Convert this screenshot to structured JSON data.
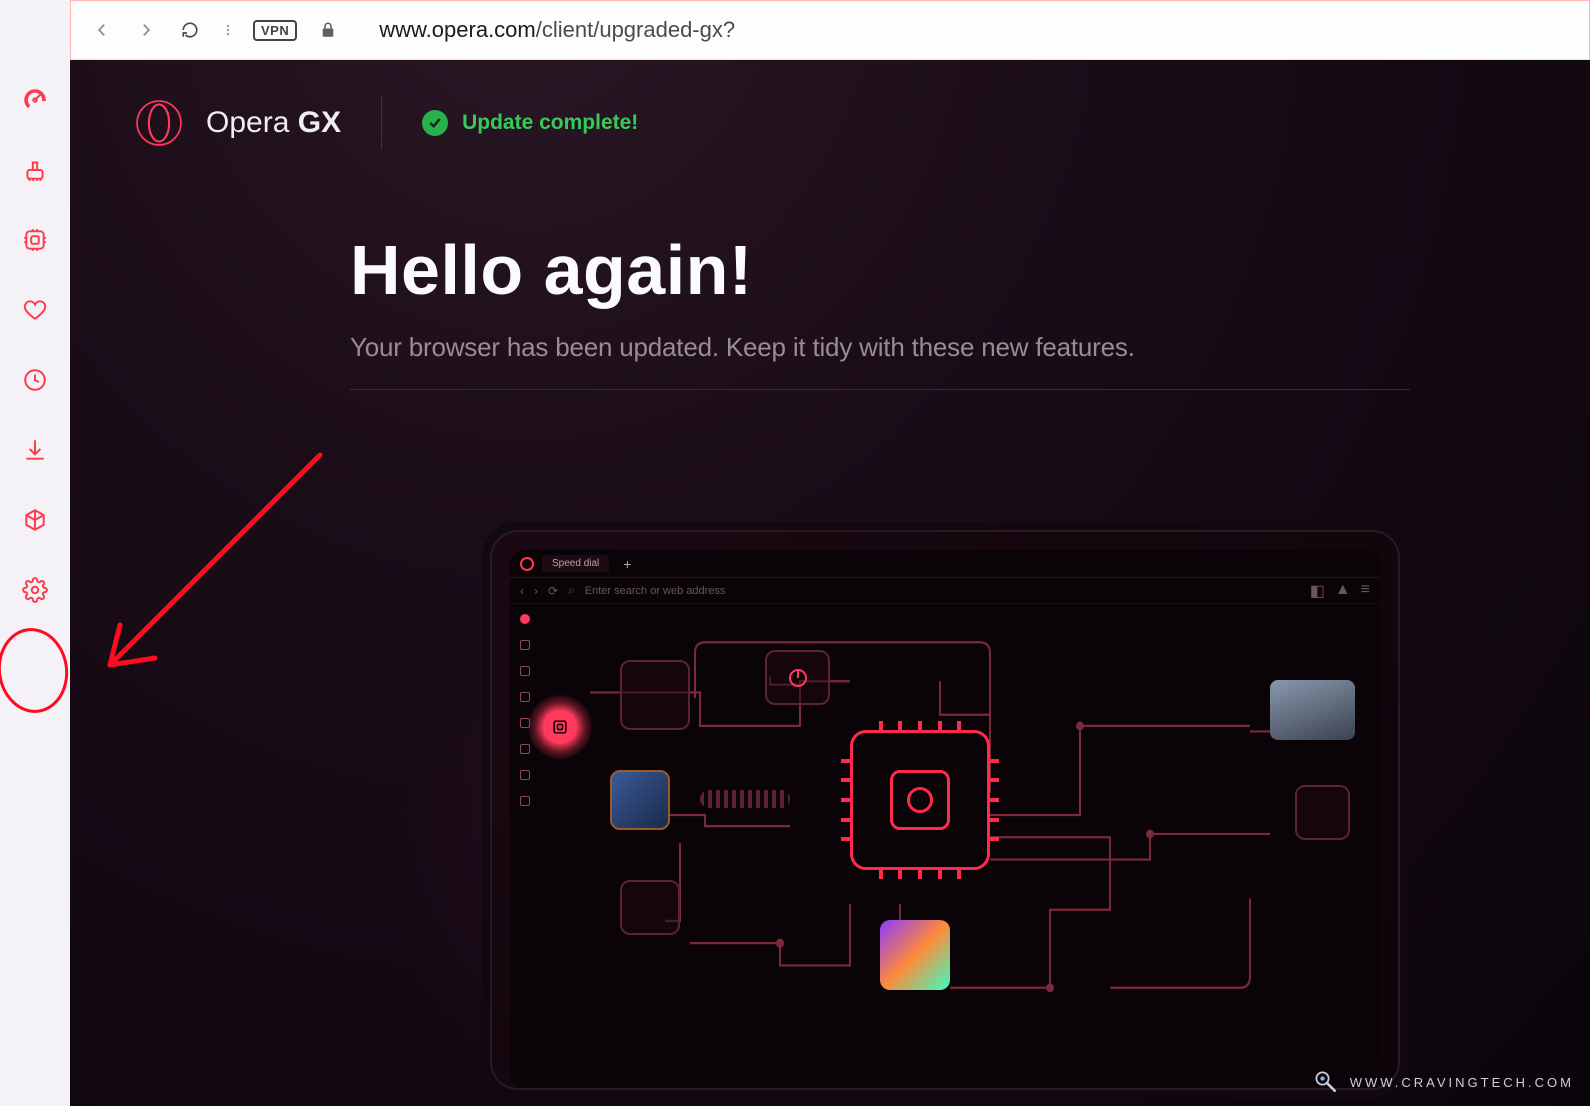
{
  "toolbar": {
    "vpn_label": "VPN",
    "url_display": "www.opera.com/client/upgraded-gx?",
    "url_host": "www.opera.com",
    "url_path": "/client/upgraded-gx?"
  },
  "sidebar": {
    "icons": [
      "speedometer-icon",
      "cleaner-icon",
      "gx-control-icon",
      "heart-icon",
      "history-icon",
      "downloads-icon",
      "extensions-icon",
      "settings-icon"
    ]
  },
  "page": {
    "brand": "Opera",
    "brand_suffix": "GX",
    "update_status": "Update complete!",
    "headline": "Hello again!",
    "subhead": "Your browser has been updated. Keep it tidy with these new features."
  },
  "laptop": {
    "tab_label": "Speed dial",
    "search_placeholder": "Enter search or web address"
  },
  "watermark": {
    "text": "WWW.CRAVINGTECH.COM"
  },
  "annotation": {
    "target": "settings-icon"
  }
}
